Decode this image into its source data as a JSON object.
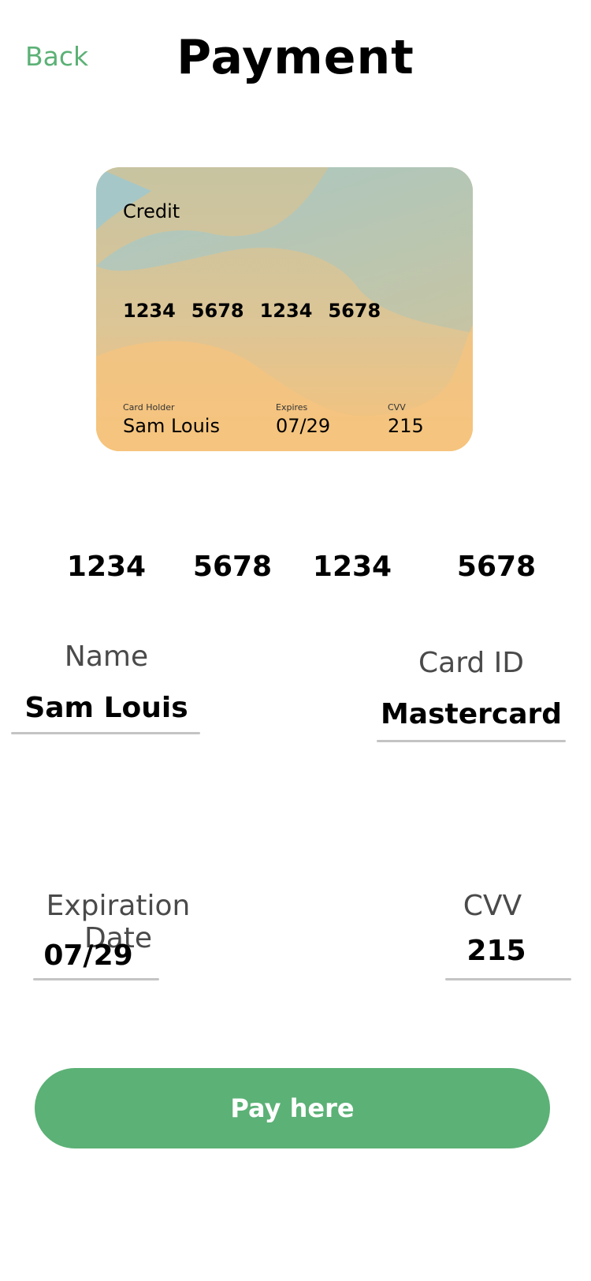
{
  "header": {
    "back_label": "Back",
    "title": "Payment"
  },
  "card": {
    "type": "Credit",
    "number_groups": [
      "1234",
      "5678",
      "1234",
      "5678"
    ],
    "holder_label": "Card Holder",
    "holder_name": "Sam Louis",
    "expires_label": "Expires",
    "expires_value": "07/29",
    "cvv_label": "CVV",
    "cvv_value": "215",
    "colors": {
      "teal": "#9fc8cf",
      "beige": "#c9c3a3",
      "orange": "#f7c27a"
    }
  },
  "card_number_row": [
    "1234",
    "5678",
    "1234",
    "5678"
  ],
  "fields": {
    "name": {
      "label": "Name",
      "value": "Sam Louis"
    },
    "card_id": {
      "label": "Card ID",
      "value": "Mastercard"
    },
    "expiration": {
      "label": "Expiration Date",
      "value": "07/29"
    },
    "cvv": {
      "label": "CVV",
      "value": "215"
    }
  },
  "pay_button": {
    "label": "Pay here"
  },
  "theme": {
    "accent": "#5cb176",
    "underline": "#c4c4c4"
  }
}
